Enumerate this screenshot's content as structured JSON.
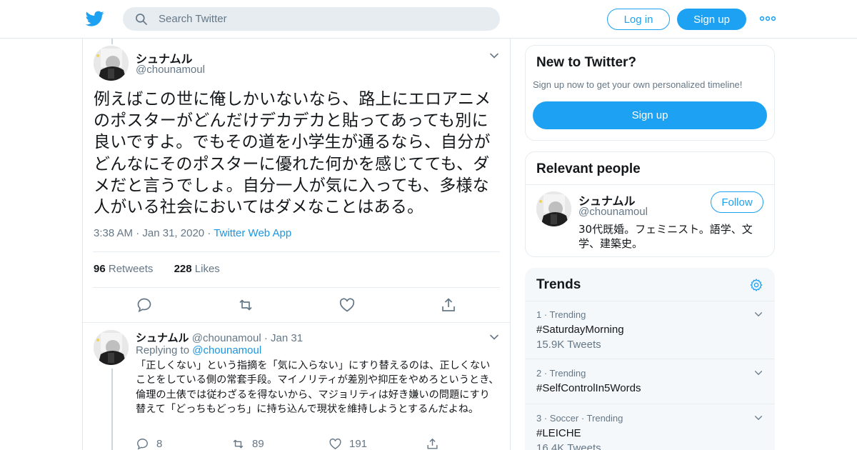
{
  "header": {
    "search_placeholder": "Search Twitter",
    "login_label": "Log in",
    "signup_label": "Sign up",
    "brand_color": "#1da1f2"
  },
  "tweet": {
    "display_name": "シュナムル",
    "handle": "@chounamoul",
    "text": "例えばこの世に俺しかいないなら、路上にエロアニメのポスターがどんだけデカデカと貼ってあっても別に良いですよ。でもその道を小学生が通るなら、自分がどんなにそのポスターに優れた何かを感じてても、ダメだと言うでしょ。自分一人が気に入っても、多様な人がいる社会においてはダメなことはある。",
    "time": "3:38 AM",
    "date": "Jan 31, 2020",
    "source": "Twitter Web App",
    "retweet_count": "96",
    "retweet_label": "Retweets",
    "like_count": "228",
    "like_label": "Likes"
  },
  "reply": {
    "display_name": "シュナムル",
    "handle": "@chounamoul",
    "date": "Jan 31",
    "replying_label": "Replying to",
    "replying_to": "@chounamoul",
    "text": "「正しくない」という指摘を「気に入らない」にすり替えるのは、正しくないことをしている側の常套手段。マイノリティが差別や抑圧をやめろというとき、倫理の土俵では従わざるを得ないから、マジョリティは好き嫌いの問題にすり替えて「どっちもどっち」に持ち込んで現状を維持しようとするんだよね。",
    "reply_count": "8",
    "retweet_count": "89",
    "like_count": "191"
  },
  "sidebar": {
    "new_title": "New to Twitter?",
    "new_sub": "Sign up now to get your own personalized timeline!",
    "new_signup": "Sign up",
    "people_title": "Relevant people",
    "person": {
      "name": "シュナムル",
      "handle": "@chounamoul",
      "bio": "30代既婚。フェミニスト。語学、文学、建築史。",
      "follow_label": "Follow"
    },
    "trends_title": "Trends",
    "trends": [
      {
        "meta": "1 · Trending",
        "name": "#SaturdayMorning",
        "count": "15.9K Tweets"
      },
      {
        "meta": "2 · Trending",
        "name": "#SelfControlIn5Words",
        "count": ""
      },
      {
        "meta": "3 · Soccer · Trending",
        "name": "#LEICHE",
        "count": "16.4K Tweets"
      }
    ]
  }
}
